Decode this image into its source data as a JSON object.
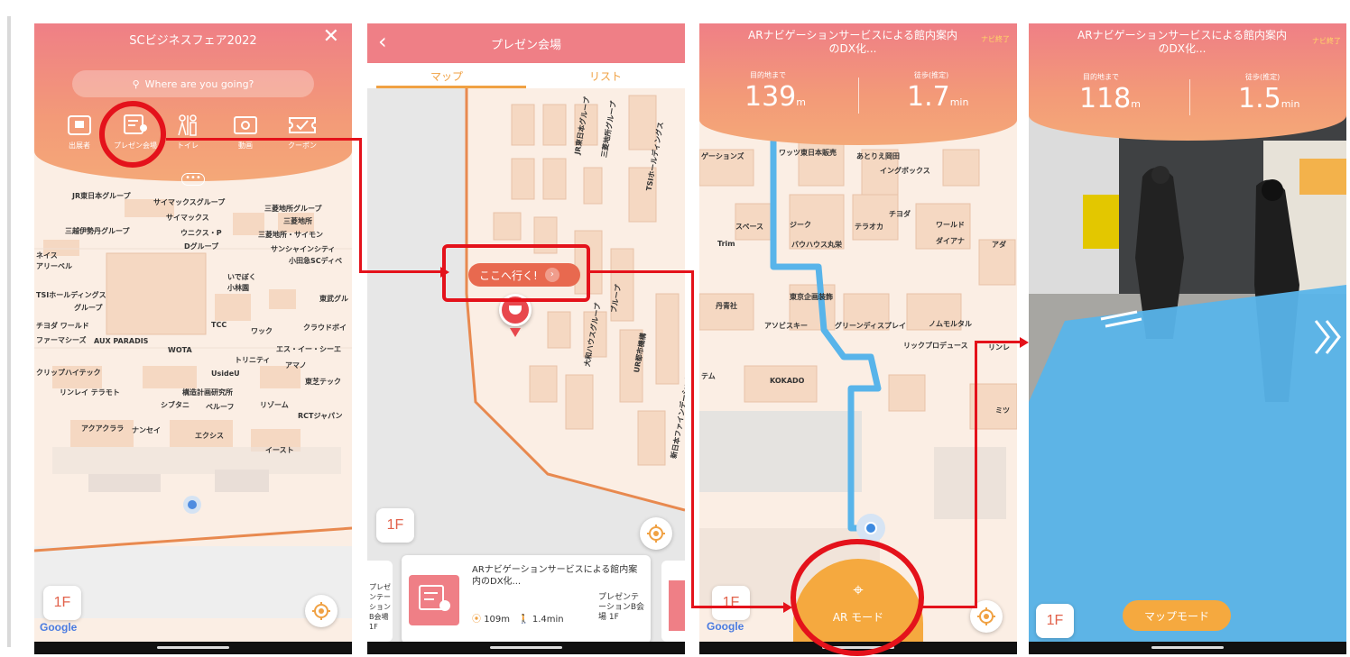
{
  "screen1": {
    "title": "SCビジネスフェア2022",
    "search_placeholder": "Where are you going?",
    "categories": [
      {
        "label": "出展者",
        "icon": "exhibitor-icon"
      },
      {
        "label": "プレゼン会場",
        "icon": "presentation-icon"
      },
      {
        "label": "トイレ",
        "icon": "toilet-icon"
      },
      {
        "label": "動画",
        "icon": "video-icon"
      },
      {
        "label": "クーポン",
        "icon": "coupon-icon"
      }
    ],
    "floor": "1F",
    "google": "Google",
    "map_labels": [
      "JR東日本グループ",
      "サイマックスグループ",
      "三菱地所グループ",
      "サイマックス",
      "三菱地所",
      "三越伊勢丹グループ",
      "ウニクス・P",
      "三菱地所・サイモン",
      "Dグループ",
      "サンシャインシティ",
      "小田急SCディベ",
      "ネイス",
      "アリーベル",
      "いでぼく",
      "小林園",
      "TSIホールディングス",
      "グループ",
      "東武グル",
      "チヨダ ワールド",
      "TCC",
      "ワック",
      "クラウドボイ",
      "ファーマシーズ",
      "AUX PARADIS",
      "WOTA",
      "エス・イー・シーエ",
      "トリニティ",
      "アマノ",
      "UsideU",
      "クリップハイテック",
      "東芝テック",
      "リンレイ テラモト",
      "構造計画研究所",
      "シブタニ",
      "ベルーフ",
      "リゾーム",
      "RCTジャパン",
      "アクアクララ",
      "ナンセイ",
      "エクシス",
      "イースト"
    ]
  },
  "screen2": {
    "title": "プレゼン会場",
    "tabs": [
      "マップ",
      "リスト"
    ],
    "go_button": "ここへ行く!",
    "floor": "1F",
    "card": {
      "title": "ARナビゲーションサービスによる館内案内のDX化...",
      "distance": "109m",
      "time": "1.4min",
      "place": "プレゼンテーションB会場 1F"
    },
    "prev_card": "プレゼンテーションB会場 1F",
    "map_labels": [
      "JR東日本グループ",
      "三菱地所グループ",
      "TSIホールディングス",
      "ブループ",
      "大和ハウスグループ",
      "UR都市機構",
      "新日本ファインデーション"
    ]
  },
  "screen3": {
    "title": "ARナビゲーションサービスによる館内案内のDX化...",
    "end_nav": "ナビ終了",
    "distance_label": "目的地まで",
    "distance_value": "139",
    "distance_unit": "m",
    "time_label": "徒歩(推定)",
    "time_value": "1.7",
    "time_unit": "min",
    "ar_mode": "AR モード",
    "floor": "1F",
    "google": "Google",
    "map_labels": [
      "ゲーションズ",
      "ワッツ東日本販売",
      "あとりえ岡田",
      "イングボックス",
      "スペース",
      "ジーク",
      "チヨダ",
      "テラオカ",
      "ワールド",
      "Trim",
      "バウハウス丸栄",
      "ダイアナ",
      "アダ",
      "丹青社",
      "東京企画装飾",
      "アソビスキー",
      "グリーンディスプレイ",
      "ノムモルタル",
      "リックプロデュース",
      "リンレ",
      "テム",
      "KOKADO",
      "ミツ"
    ]
  },
  "screen4": {
    "title": "ARナビゲーションサービスによる館内案内のDX化...",
    "end_nav": "ナビ終了",
    "distance_label": "目的地まで",
    "distance_value": "118",
    "distance_unit": "m",
    "time_label": "徒歩(推定)",
    "time_value": "1.5",
    "time_unit": "min",
    "map_mode": "マップモード",
    "floor": "1F"
  },
  "colors": {
    "accent": "#f08a7a",
    "highlight": "#e4121b",
    "route": "#58b4ea",
    "ar_button": "#f5a93f"
  }
}
